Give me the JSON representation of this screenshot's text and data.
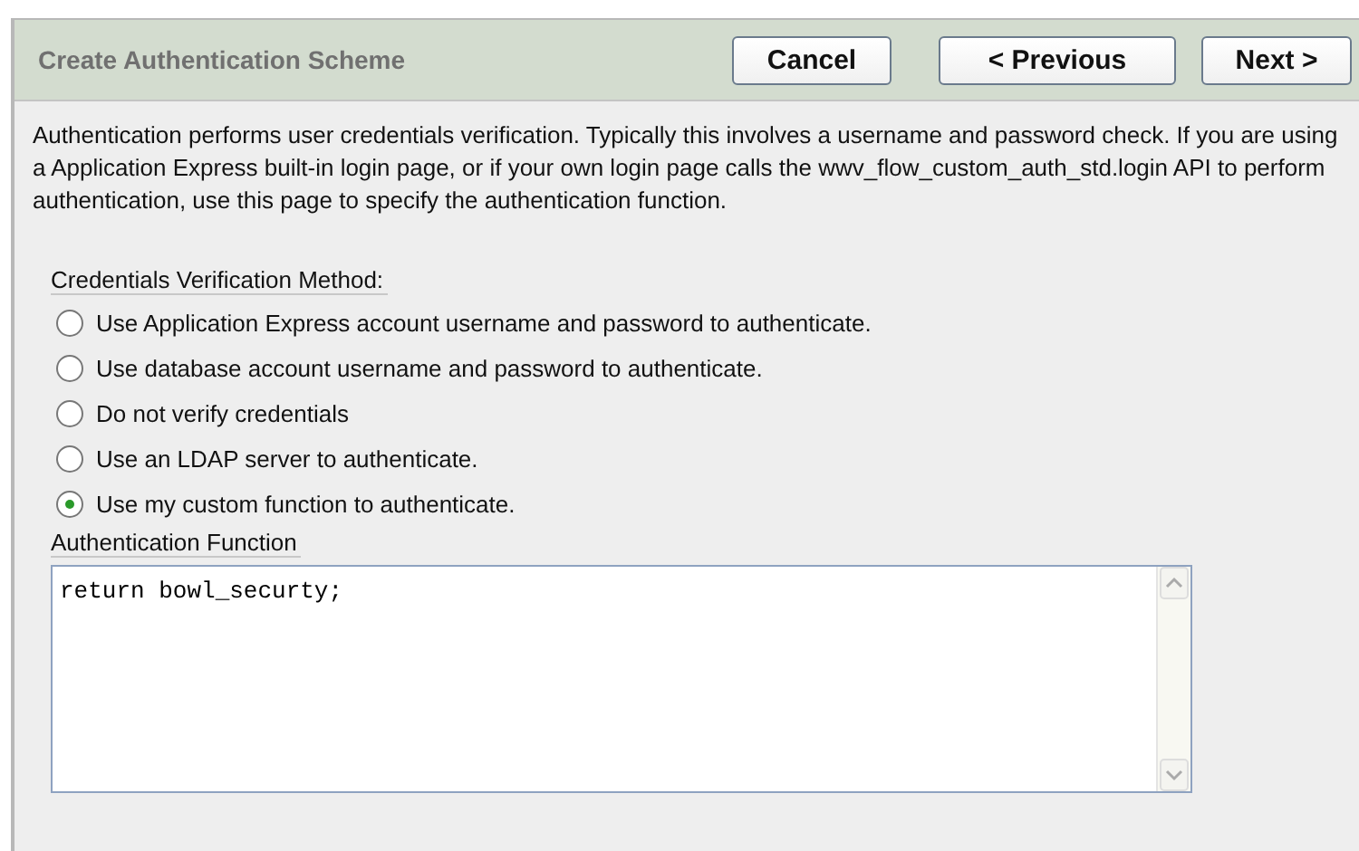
{
  "header": {
    "title": "Create Authentication Scheme",
    "buttons": [
      "Cancel",
      "< Previous",
      "Next >"
    ]
  },
  "description": "Authentication performs user credentials verification. Typically this involves a username and password check. If you are using a Application Express built-in login page, or if your own login page calls the wwv_flow_custom_auth_std.login API to perform authentication, use this page to specify the authentication function.",
  "method": {
    "label": "Credentials Verification Method:",
    "options": [
      {
        "label": "Use Application Express account username and password to authenticate.",
        "selected": false
      },
      {
        "label": "Use database account username and password to authenticate.",
        "selected": false
      },
      {
        "label": "Do not verify credentials",
        "selected": false
      },
      {
        "label": "Use an LDAP server to authenticate.",
        "selected": false
      },
      {
        "label": "Use my custom function to authenticate.",
        "selected": true
      }
    ]
  },
  "function": {
    "label": "Authentication Function",
    "value": "return bowl_securty;"
  }
}
